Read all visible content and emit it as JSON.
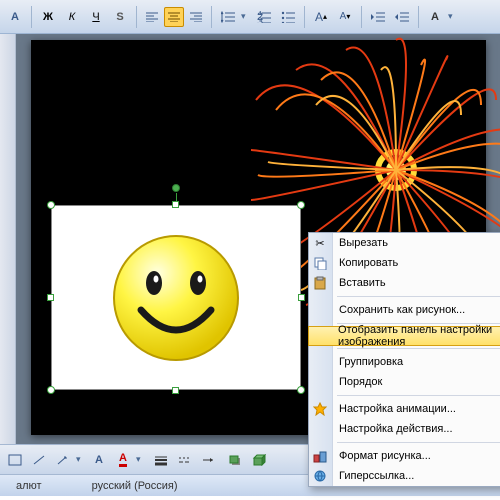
{
  "context_menu": {
    "cut": "Вырезать",
    "copy": "Копировать",
    "paste": "Вставить",
    "save_as_picture": "Сохранить как рисунок...",
    "show_picture_toolbar": "Отобразить панель настройки изображения",
    "grouping": "Группировка",
    "order": "Порядок",
    "animation_settings": "Настройка анимации...",
    "action_settings": "Настройка действия...",
    "format_picture": "Формат рисунка...",
    "hyperlink": "Гиперссылка..."
  },
  "status": {
    "slide_title": "алют",
    "language": "русский (Россия)"
  },
  "colors": {
    "toolbar_bg": "#e8edf5",
    "highlight": "#ffe16a",
    "slide_bg": "#000000"
  }
}
